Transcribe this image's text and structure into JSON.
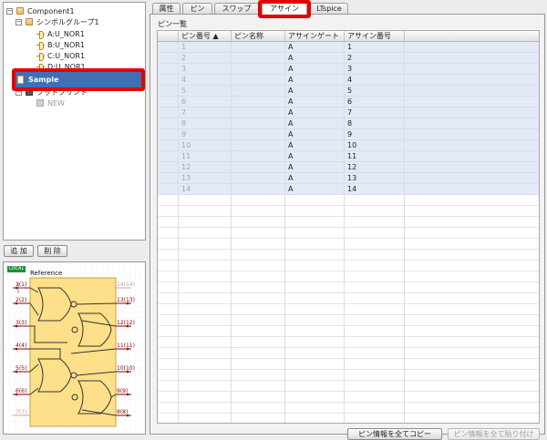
{
  "tree": {
    "component": "Component1",
    "symbol_group": "シンボルグループ1",
    "gates": [
      "A:U_NOR1",
      "B:U_NOR1",
      "C:U_NOR1",
      "D:U_NOR1"
    ],
    "selected_item": "Sample",
    "footprint_group": "フットプリント",
    "new_item": "NEW"
  },
  "tree_buttons": {
    "add": "追 加",
    "delete": "削 除"
  },
  "preview": {
    "badge": "LOCAL",
    "reference": "Reference",
    "left_pins": [
      "1(1)",
      "2(2)",
      "3(3)",
      "4(4)",
      "5(5)",
      "6(6)",
      "7(7)"
    ],
    "right_pins": [
      "14(14)",
      "13(13)",
      "12(12)",
      "11(11)",
      "10(10)",
      "9(9)",
      "8(8)"
    ]
  },
  "tabs": [
    "属性",
    "ピン",
    "スワップ",
    "アサイン",
    "LTspice"
  ],
  "active_tab": "アサイン",
  "section_title": "ピン一覧",
  "table": {
    "columns": [
      "ピン番号 ▲",
      "ピン名称",
      "アサインゲート",
      "アサイン番号"
    ],
    "rows": [
      [
        "1",
        "",
        "A",
        "1"
      ],
      [
        "2",
        "",
        "A",
        "2"
      ],
      [
        "3",
        "",
        "A",
        "3"
      ],
      [
        "4",
        "",
        "A",
        "4"
      ],
      [
        "5",
        "",
        "A",
        "5"
      ],
      [
        "6",
        "",
        "A",
        "6"
      ],
      [
        "7",
        "",
        "A",
        "7"
      ],
      [
        "8",
        "",
        "A",
        "8"
      ],
      [
        "9",
        "",
        "A",
        "9"
      ],
      [
        "10",
        "",
        "A",
        "10"
      ],
      [
        "11",
        "",
        "A",
        "11"
      ],
      [
        "12",
        "",
        "A",
        "12"
      ],
      [
        "13",
        "",
        "A",
        "13"
      ],
      [
        "14",
        "",
        "A",
        "14"
      ]
    ]
  },
  "buttons": {
    "copy_all": "ピン情報を全てコピー",
    "paste_all": "ピン情報を全て貼り付け"
  },
  "colors": {
    "highlight_red": "#e60000",
    "selection_blue": "#3f6fb5",
    "row_fill": "#e3e9f6",
    "symbol_body": "#ffe08a",
    "pin_color": "#8b0000"
  }
}
